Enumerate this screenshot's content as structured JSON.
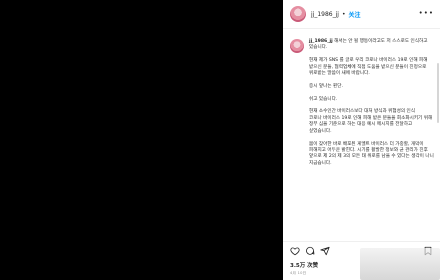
{
  "header": {
    "username": "jj_1986_jj",
    "separator": "•",
    "follow_label": "关注",
    "more_label": "•••"
  },
  "caption": {
    "username": "jj_1986_jj",
    "text": "해서는 안 될 행동이라고도 저 스스로도 인식하고 있습니다.\n\n현재 제가 SNS 를 글로 우리 코로나 바이러스 19로 인해 피해 받으신 분들, 협력업체에 직접 도움을 받으신 분들이 진정으로 위로받는 말씀이 새에 바랍니다.\n\n증시 앞나는 핀단.\n\n쉬고 있습니다.\n\n현재 소수인간 바이러스보다 대처 방식과 위험성의 인식\n코로나 바이러스 19로 인해 피해 받은 분들을 회소화시키기 위해 정부 심을 기준으로 하는 대응 예시 메시지를 전달하고 싶었습니다.\n\n몸이 잦아한 바로 배포된 게엘트 바이러스 더 가중할, 개막이 피해지고 어두운 밝힌다. 시기를 활발한 정보와 균 관리가 진후 앞으로 제 2의 제 3의 모든 태 위로를 남을 수 있다는 생각이 나니 지금습니다."
  },
  "actions": {
    "like_icon": "heart-icon",
    "comment_icon": "comment-icon",
    "share_icon": "send-icon",
    "save_icon": "bookmark-icon"
  },
  "stats": {
    "likes": "3.5万 次赞",
    "date": "4月 10日"
  }
}
